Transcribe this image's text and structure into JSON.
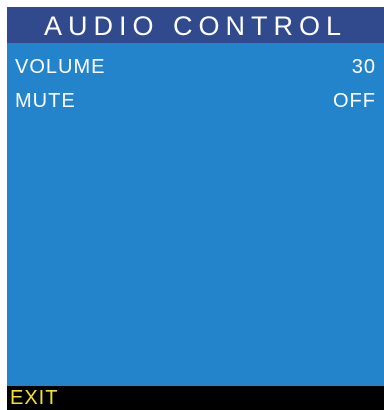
{
  "menu": {
    "title": "AUDIO CONTROL",
    "items": [
      {
        "label": "VOLUME",
        "value": "30"
      },
      {
        "label": "MUTE",
        "value": "OFF"
      }
    ],
    "exit_label": "EXIT"
  },
  "colors": {
    "title_bar": "#314a8e",
    "panel": "#2384cc",
    "text": "#ffffff",
    "footer": "#000000",
    "exit_text": "#f2e030",
    "border": "#ffffff"
  }
}
